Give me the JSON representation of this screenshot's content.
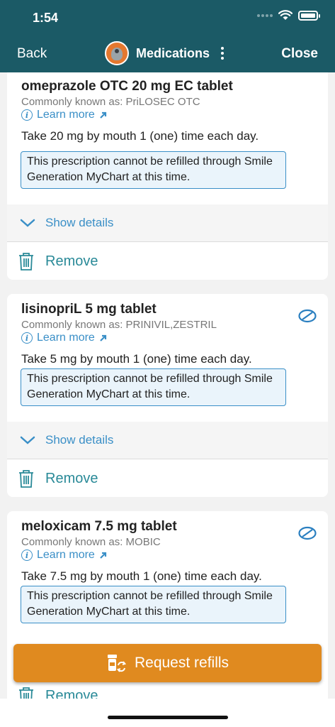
{
  "status_bar": {
    "time": "1:54"
  },
  "nav": {
    "back_label": "Back",
    "title": "Medications",
    "close_label": "Close"
  },
  "medications": [
    {
      "name": "omeprazole OTC 20 mg EC tablet",
      "common_name": "Commonly known as: PriLOSEC OTC",
      "learn_more": "Learn more",
      "sig": "Take 20 mg by mouth 1 (one) time each day.",
      "refill_note": "This prescription cannot be refilled through Smile Generation MyChart at this time.",
      "show_details": "Show details",
      "remove": "Remove"
    },
    {
      "name": "lisinopriL 5 mg tablet",
      "common_name": "Commonly known as: PRINIVIL,ZESTRIL",
      "learn_more": "Learn more",
      "sig": "Take 5 mg by mouth 1 (one) time each day.",
      "refill_note": "This prescription cannot be refilled through Smile Generation MyChart at this time.",
      "show_details": "Show details",
      "remove": "Remove"
    },
    {
      "name": "meloxicam 7.5 mg tablet",
      "common_name": "Commonly known as: MOBIC",
      "learn_more": "Learn more",
      "sig": "Take 7.5 mg by mouth 1 (one) time each day.",
      "refill_note": "This prescription cannot be refilled through Smile Generation MyChart at this time.",
      "remove": "Remove"
    }
  ],
  "request_refills": "Request refills",
  "colors": {
    "header": "#1b5a66",
    "accent": "#3a8fc7",
    "teal_text": "#2a8a98",
    "primary_button": "#e08a1f"
  }
}
